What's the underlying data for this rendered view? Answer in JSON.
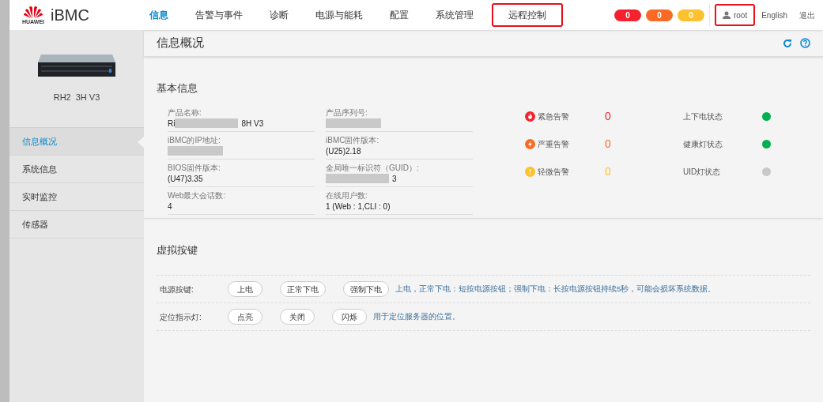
{
  "header": {
    "logo_caption": "HUAWEI",
    "product": "iBMC",
    "nav": [
      {
        "label": "信息",
        "selected": true,
        "highlighted": false
      },
      {
        "label": "告警与事件",
        "selected": false,
        "highlighted": false
      },
      {
        "label": "诊断",
        "selected": false,
        "highlighted": false
      },
      {
        "label": "电源与能耗",
        "selected": false,
        "highlighted": false
      },
      {
        "label": "配置",
        "selected": false,
        "highlighted": false
      },
      {
        "label": "系统管理",
        "selected": false,
        "highlighted": false
      },
      {
        "label": "远程控制",
        "selected": false,
        "highlighted": true
      }
    ],
    "alert_badges": [
      {
        "count": "0",
        "color": "#f5222d"
      },
      {
        "count": "0",
        "color": "#fa6a24"
      },
      {
        "count": "0",
        "color": "#fcc12e"
      }
    ],
    "user": {
      "name": "root",
      "highlighted": true
    },
    "language": "English",
    "logout": "退出"
  },
  "sidebar": {
    "device_name_start": "RH2",
    "device_name_end": "3H V3",
    "items": [
      {
        "label": "信息概况",
        "selected": true
      },
      {
        "label": "系统信息",
        "selected": false
      },
      {
        "label": "实时监控",
        "selected": false
      },
      {
        "label": "传感器",
        "selected": false
      }
    ]
  },
  "page": {
    "title": "信息概况",
    "basic_info": {
      "title": "基本信息",
      "fields": [
        {
          "label": "产品名称:",
          "value_start": "Ri",
          "value_end": "8H V3",
          "redacted": true
        },
        {
          "label": "产品序列号:",
          "redacted": true
        },
        {
          "label": "iBMC的IP地址:",
          "redacted": true
        },
        {
          "label": "iBMC固件版本:",
          "value_start": "(U25)2.18",
          "redacted": false
        },
        {
          "label": "BIOS固件版本:",
          "value_start": "(U47)3.35",
          "redacted": false
        },
        {
          "label": "全局唯一标识符（GUID）:",
          "value_end": "3",
          "redacted": true
        },
        {
          "label": "Web最大会话数:",
          "value_start": "4",
          "redacted": false
        },
        {
          "label": "在线用户数:",
          "value_start": "1 (Web : 1,CLI : 0)",
          "redacted": false
        }
      ],
      "alarms": [
        {
          "kind": "critical",
          "label": "紧急告警",
          "count": "0",
          "color": "#f5222d"
        },
        {
          "kind": "major",
          "label": "严重告警",
          "count": "0",
          "color": "#fa6a24"
        },
        {
          "kind": "minor",
          "label": "轻微告警",
          "count": "0",
          "color": "#fcc12e"
        }
      ],
      "statuses": [
        {
          "label": "上下电状态",
          "color": "#00b050"
        },
        {
          "label": "健康灯状态",
          "color": "#00b050"
        },
        {
          "label": "UID灯状态",
          "color": "#c8c8c8"
        }
      ]
    },
    "virtual_buttons": {
      "title": "虚拟按键",
      "rows": [
        {
          "label": "电源按键:",
          "buttons": [
            "上电",
            "正常下电",
            "强制下电"
          ],
          "note": "上电，正常下电：短按电源按钮；强制下电：长按电源按钮持续5秒，可能会损坏系统数据。"
        },
        {
          "label": "定位指示灯:",
          "buttons": [
            "点亮",
            "关闭",
            "闪烁"
          ],
          "note": "用于定位服务器的位置。"
        }
      ]
    }
  }
}
